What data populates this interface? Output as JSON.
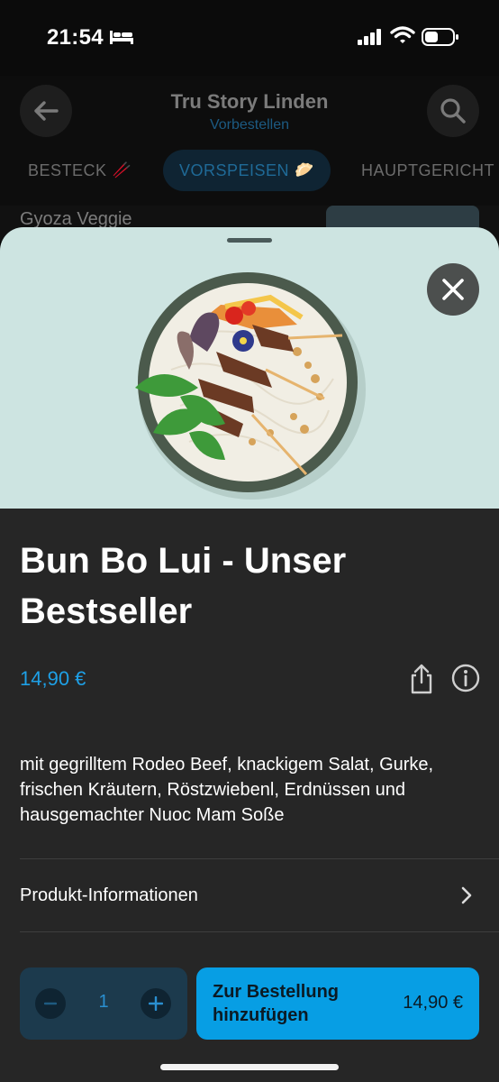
{
  "status_bar": {
    "time": "21:54",
    "icons": [
      "bed-icon",
      "signal-icon",
      "wifi-icon",
      "battery-icon"
    ]
  },
  "header": {
    "title": "Tru Story Linden",
    "subtitle": "Vorbestellen",
    "back_icon": "arrow-left-icon",
    "search_icon": "search-icon",
    "tabs": [
      {
        "label": "BESTECK",
        "emoji": "🥢"
      },
      {
        "label": "VORSPEISEN",
        "emoji": "🥟",
        "active": true
      },
      {
        "label": "HAUPTGERICHT"
      }
    ]
  },
  "background_list": {
    "peek_item": "Gyoza Veggie"
  },
  "product": {
    "image_icon": "bun-bo-bowl-image",
    "title": "Bun Bo Lui - Unser Bestseller",
    "price": "14,90 €",
    "description": "mit gegrilltem Rodeo Beef, knackigem Salat, Gurke, frischen Kräutern, Röstzwiebenl, Erdnüssen und hausgemachter Nuoc Mam Soße",
    "info_row_label": "Produkt-Informationen"
  },
  "order": {
    "quantity": "1",
    "add_button_label": "Zur Bestellung hinzufügen",
    "add_button_price": "14,90 €"
  },
  "colors": {
    "accent": "#079ee4",
    "price": "#1ea0e6",
    "sheet_bg": "#262626",
    "hero_bg": "#cde4e1"
  }
}
